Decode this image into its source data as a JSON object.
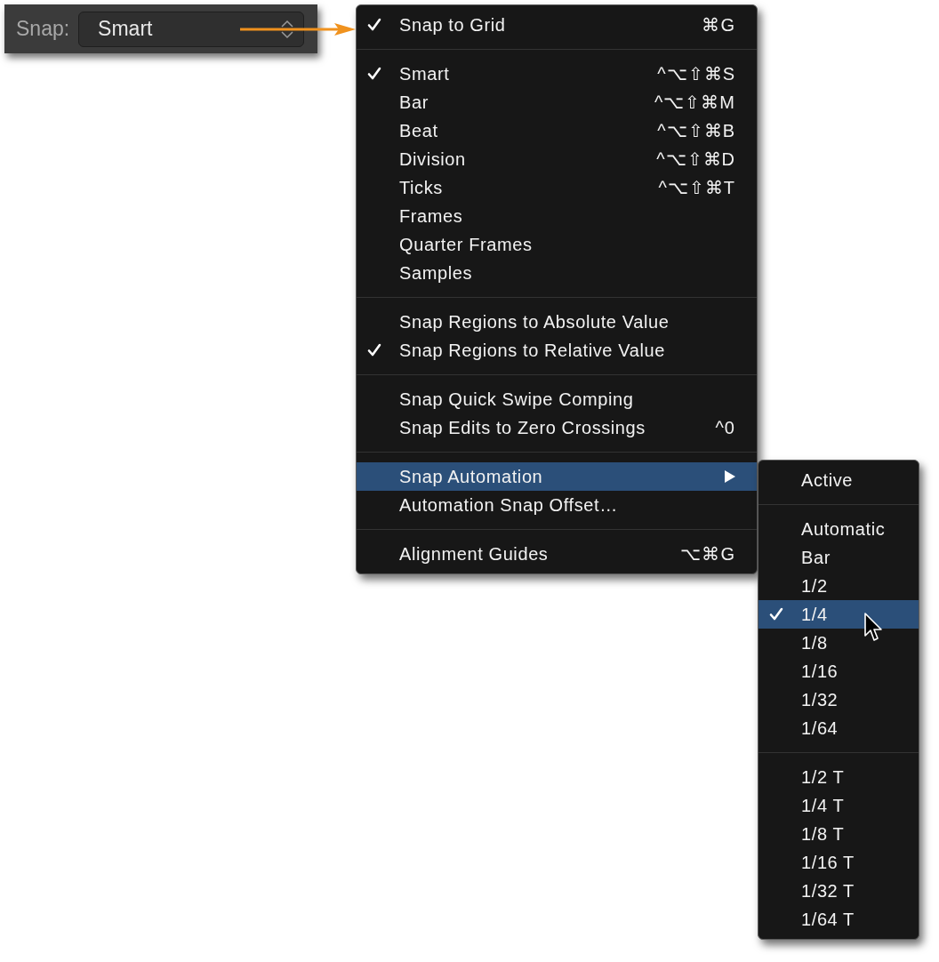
{
  "toolbar": {
    "label": "Snap:",
    "popup": {
      "value": "Smart"
    }
  },
  "menu": {
    "sections": [
      [
        {
          "label": "Snap to Grid",
          "shortcut": "⌘G",
          "checked": true,
          "selected": false,
          "submenu": false
        }
      ],
      [
        {
          "label": "Smart",
          "shortcut": "^⌥⇧⌘S",
          "checked": true,
          "selected": false,
          "submenu": false
        },
        {
          "label": "Bar",
          "shortcut": "^⌥⇧⌘M",
          "checked": false,
          "selected": false,
          "submenu": false
        },
        {
          "label": "Beat",
          "shortcut": "^⌥⇧⌘B",
          "checked": false,
          "selected": false,
          "submenu": false
        },
        {
          "label": "Division",
          "shortcut": "^⌥⇧⌘D",
          "checked": false,
          "selected": false,
          "submenu": false
        },
        {
          "label": "Ticks",
          "shortcut": "^⌥⇧⌘T",
          "checked": false,
          "selected": false,
          "submenu": false
        },
        {
          "label": "Frames",
          "checked": false,
          "selected": false,
          "submenu": false
        },
        {
          "label": "Quarter Frames",
          "checked": false,
          "selected": false,
          "submenu": false
        },
        {
          "label": "Samples",
          "checked": false,
          "selected": false,
          "submenu": false
        }
      ],
      [
        {
          "label": "Snap Regions to Absolute Value",
          "checked": false,
          "selected": false,
          "submenu": false
        },
        {
          "label": "Snap Regions to Relative Value",
          "checked": true,
          "selected": false,
          "submenu": false
        }
      ],
      [
        {
          "label": "Snap Quick Swipe Comping",
          "checked": false,
          "selected": false,
          "submenu": false
        },
        {
          "label": "Snap Edits to Zero Crossings",
          "shortcut": "^0",
          "checked": false,
          "selected": false,
          "submenu": false
        }
      ],
      [
        {
          "label": "Snap Automation",
          "checked": false,
          "selected": true,
          "submenu": true
        },
        {
          "label": "Automation Snap Offset…",
          "checked": false,
          "selected": false,
          "submenu": false
        }
      ],
      [
        {
          "label": "Alignment Guides",
          "shortcut": "⌥⌘G",
          "checked": false,
          "selected": false,
          "submenu": false
        }
      ]
    ]
  },
  "submenu": {
    "sections": [
      [
        {
          "label": "Active",
          "checked": false,
          "selected": false
        }
      ],
      [
        {
          "label": "Automatic",
          "checked": false,
          "selected": false
        },
        {
          "label": "Bar",
          "checked": false,
          "selected": false
        },
        {
          "label": "1/2",
          "checked": false,
          "selected": false
        },
        {
          "label": "1/4",
          "checked": true,
          "selected": true
        },
        {
          "label": "1/8",
          "checked": false,
          "selected": false
        },
        {
          "label": "1/16",
          "checked": false,
          "selected": false
        },
        {
          "label": "1/32",
          "checked": false,
          "selected": false
        },
        {
          "label": "1/64",
          "checked": false,
          "selected": false
        }
      ],
      [
        {
          "label": "1/2 T",
          "checked": false,
          "selected": false
        },
        {
          "label": "1/4 T",
          "checked": false,
          "selected": false
        },
        {
          "label": "1/8 T",
          "checked": false,
          "selected": false
        },
        {
          "label": "1/16 T",
          "checked": false,
          "selected": false
        },
        {
          "label": "1/32 T",
          "checked": false,
          "selected": false
        },
        {
          "label": "1/64 T",
          "checked": false,
          "selected": false
        }
      ]
    ]
  }
}
